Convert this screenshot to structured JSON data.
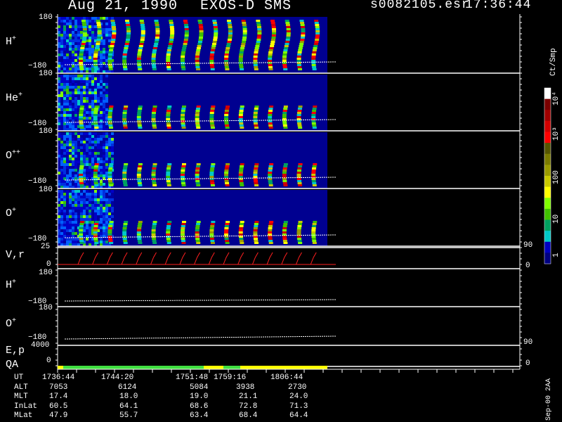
{
  "header": {
    "date": "Aug 21, 1990",
    "instrument": "EXOS-D SMS",
    "file": "s0082105.esr",
    "time": "17:36:44"
  },
  "panels": {
    "h_plus": {
      "label": "H",
      "sup": "+",
      "top": "180",
      "bottom": "−180"
    },
    "he_plus": {
      "label": "He",
      "sup": "+",
      "top": "180",
      "bottom": "−180"
    },
    "o_pp": {
      "label": "O",
      "sup": "++",
      "top": "180",
      "bottom": "−180"
    },
    "o_plus": {
      "label": "O",
      "sup": "+",
      "top": "180",
      "bottom": "−180"
    },
    "vr": {
      "label": "V,r",
      "top": "25",
      "bottom": "0",
      "right_top": "90",
      "right_bottom": "0"
    },
    "h_plus_2": {
      "label": "H",
      "sup": "+",
      "top": "180",
      "bottom": "−180"
    },
    "o_plus_2": {
      "label": "O",
      "sup": "+",
      "top": "180",
      "bottom": "−180"
    },
    "ep": {
      "label": "E,p",
      "top": "4000",
      "bottom": "0",
      "right_top": "90",
      "right_bottom": "0"
    },
    "qa": {
      "label": "QA"
    }
  },
  "colorbar": {
    "unit": "Ct/Smp",
    "labels": [
      "10⁴",
      "10³",
      "100",
      "10",
      "1"
    ],
    "colors": [
      "#ffffff",
      "#7a0000",
      "#a00000",
      "#d00000",
      "#ff0000",
      "#555500",
      "#7a7a00",
      "#9a9a00",
      "#c8c800",
      "#ffff00",
      "#80ff00",
      "#40c000",
      "#00a060",
      "#00c8c8",
      "#0000c0",
      "#000080"
    ]
  },
  "footer": {
    "rows": [
      {
        "label": "UT",
        "values": [
          "1736:44",
          "1744:20",
          "1751:48",
          "1759:16",
          "1806:44"
        ]
      },
      {
        "label": "ALT",
        "values": [
          "7053",
          "6124",
          "5084",
          "3938",
          "2730"
        ]
      },
      {
        "label": "MLT",
        "values": [
          "17.4",
          "18.0",
          "19.0",
          "21.1",
          "24.0"
        ]
      },
      {
        "label": "InLat",
        "values": [
          "60.5",
          "64.1",
          "68.6",
          "72.8",
          "71.3"
        ]
      },
      {
        "label": "MLat",
        "values": [
          "47.9",
          "55.7",
          "63.4",
          "68.4",
          "64.4"
        ]
      }
    ],
    "side_note": "Sep-00 2AA"
  },
  "chart_data": {
    "type": "heatmap",
    "title": "Aug 21, 1990   EXOS-D SMS",
    "x": [
      "1736:44",
      "1744:20",
      "1751:48",
      "1759:16",
      "1806:44"
    ],
    "xlabel": "UT",
    "panels": [
      "H+",
      "He+",
      "O++",
      "O+",
      "V,r",
      "H+",
      "O+",
      "E,p",
      "QA"
    ],
    "ylim_pitch": [
      -180,
      180
    ],
    "colorbar_unit": "Ct/Smp",
    "colorbar_range": [
      1,
      10000
    ],
    "colorbar_scale": "log",
    "spin_cycles": 17,
    "qa_segments": [
      {
        "from": "1736:44",
        "to": "1736:55",
        "quality": "yellow"
      },
      {
        "from": "1736:55",
        "to": "1757:30",
        "quality": "green"
      },
      {
        "from": "1757:30",
        "to": "1759:50",
        "quality": "yellow"
      },
      {
        "from": "1759:50",
        "to": "1761:50",
        "quality": "green"
      },
      {
        "from": "1761:50",
        "to": "1806:44",
        "quality": "yellow"
      }
    ]
  }
}
